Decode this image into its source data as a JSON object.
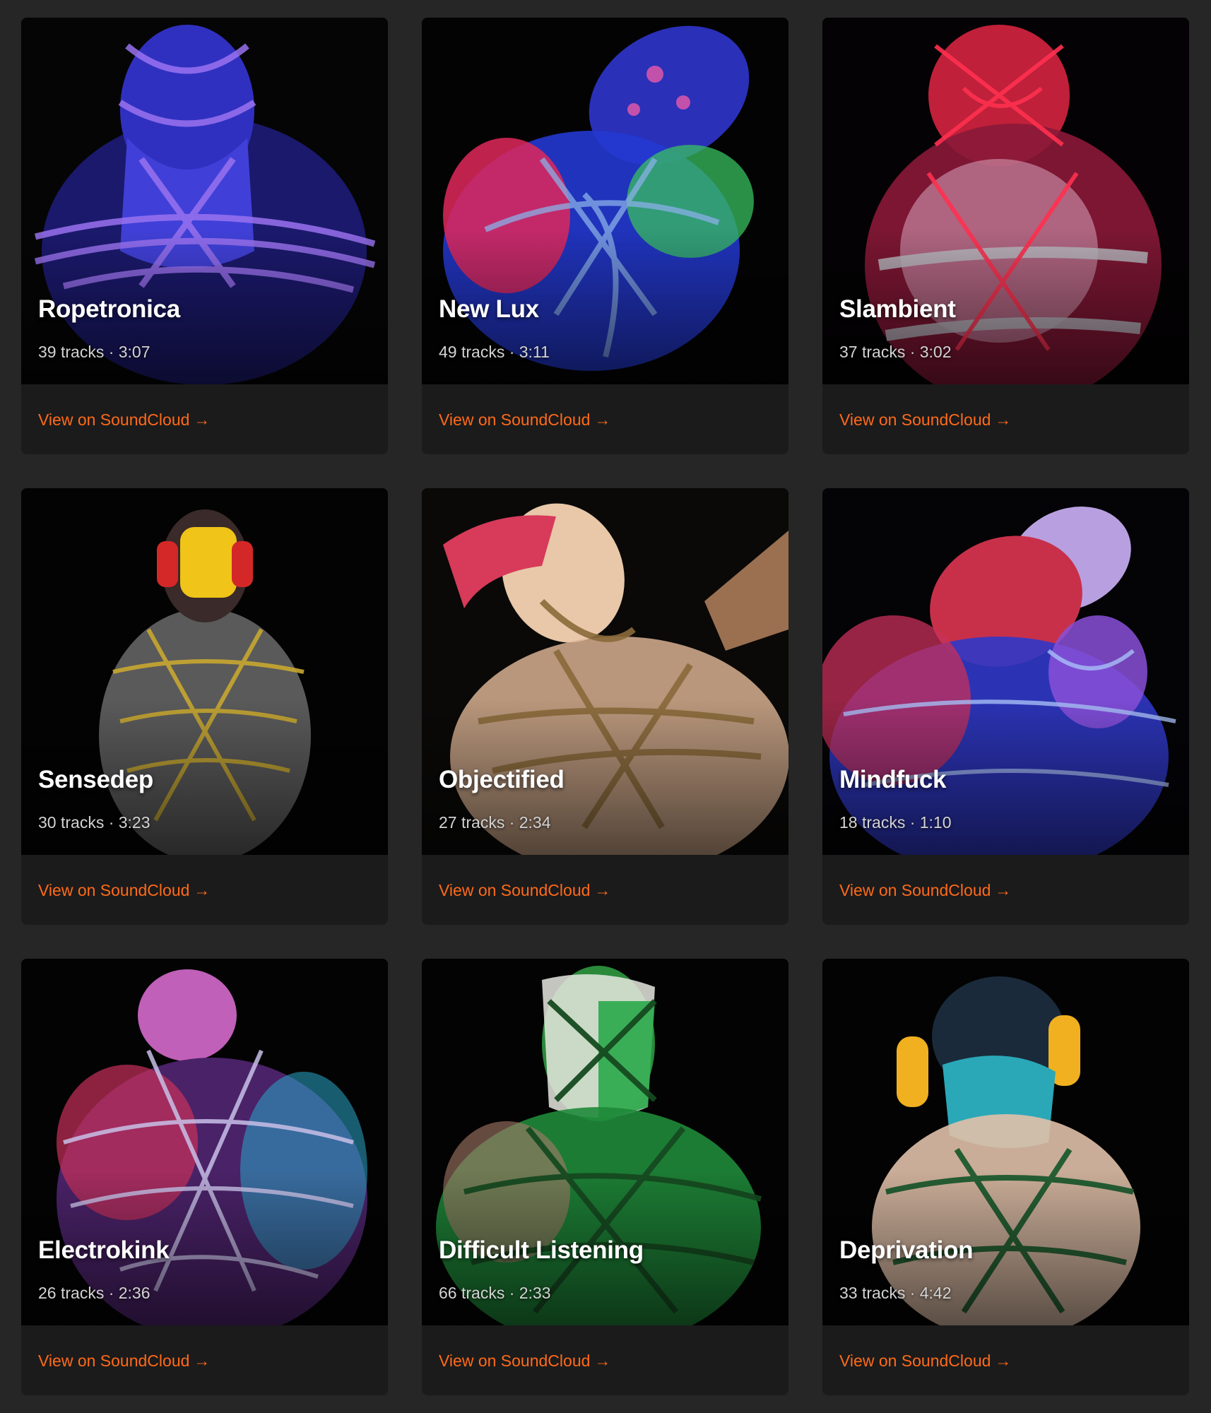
{
  "link_label": "View on SoundCloud",
  "link_arrow": "→",
  "accent_color": "#ff6a1a",
  "playlists": [
    {
      "title": "Ropetronica",
      "tracks": "39 tracks",
      "duration": "3:07",
      "meta": "39 tracks · 3:07",
      "palette": [
        "#3a3ad8",
        "#8a5cf0",
        "#1c1a6a"
      ]
    },
    {
      "title": "New Lux",
      "tracks": "49 tracks",
      "duration": "3:11",
      "meta": "49 tracks · 3:11",
      "palette": [
        "#e8305a",
        "#2a3ee0",
        "#3ec96a"
      ]
    },
    {
      "title": "Slambient",
      "tracks": "37 tracks",
      "duration": "3:02",
      "meta": "37 tracks · 3:02",
      "palette": [
        "#e0203a",
        "#b9b9c0",
        "#6a1428"
      ]
    },
    {
      "title": "Sensedep",
      "tracks": "30 tracks",
      "duration": "3:23",
      "meta": "30 tracks · 3:23",
      "palette": [
        "#f0c020",
        "#7a7a7a",
        "#d42828"
      ]
    },
    {
      "title": "Objectified",
      "tracks": "27 tracks",
      "duration": "2:34",
      "meta": "27 tracks · 2:34",
      "palette": [
        "#e8c7a8",
        "#8a6a3a",
        "#d83a5a"
      ]
    },
    {
      "title": "Mindfuck",
      "tracks": "18 tracks",
      "duration": "1:10",
      "meta": "18 tracks · 1:10",
      "palette": [
        "#d8304a",
        "#3a44e0",
        "#c8a0e8"
      ]
    },
    {
      "title": "Electrokink",
      "tracks": "26 tracks",
      "duration": "2:36",
      "meta": "26 tracks · 2:36",
      "palette": [
        "#5a2a70",
        "#d83a5a",
        "#2aa8c8"
      ]
    },
    {
      "title": "Difficult Listening",
      "tracks": "66 tracks",
      "duration": "2:33",
      "meta": "66 tracks · 2:33",
      "palette": [
        "#2aa84a",
        "#e8e8e0",
        "#1a5a2a"
      ]
    },
    {
      "title": "Deprivation",
      "tracks": "33 tracks",
      "duration": "4:42",
      "meta": "33 tracks · 4:42",
      "palette": [
        "#e8c8b0",
        "#f0b020",
        "#2aa8b8"
      ]
    }
  ]
}
